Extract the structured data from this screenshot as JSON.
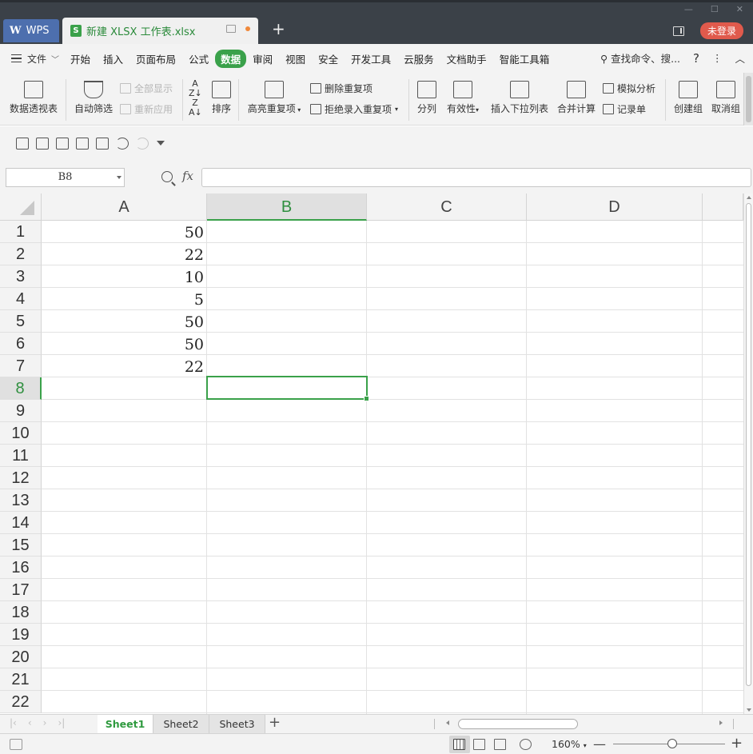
{
  "titlebar": {
    "app_tab": "WPS",
    "doc_tab": "新建 XLSX 工作表.xlsx",
    "new_tab": "+",
    "login": "未登录"
  },
  "menu": {
    "file": "文件",
    "items": [
      "开始",
      "插入",
      "页面布局",
      "公式",
      "数据",
      "审阅",
      "视图",
      "安全",
      "开发工具",
      "云服务",
      "文档助手",
      "智能工具箱"
    ],
    "active": "数据",
    "search": "查找命令、搜..."
  },
  "ribbon": {
    "pivot": "数据透视表",
    "autofilter": "自动筛选",
    "show_all": "全部显示",
    "reapply": "重新应用",
    "sort": "排序",
    "highlight_dup": "高亮重复项",
    "remove_dup": "删除重复项",
    "reject_dup": "拒绝录入重复项",
    "split": "分列",
    "validity": "有效性",
    "dropdown": "插入下拉列表",
    "consolidate": "合并计算",
    "whatif": "模拟分析",
    "record": "记录单",
    "group": "创建组",
    "ungroup": "取消组"
  },
  "formula": {
    "namebox": "B8",
    "fx": "fx",
    "value": ""
  },
  "grid": {
    "columns": [
      "A",
      "B",
      "C",
      "D"
    ],
    "selected_column": "B",
    "rows": [
      "1",
      "2",
      "3",
      "4",
      "5",
      "6",
      "7",
      "8",
      "9",
      "10",
      "11",
      "12",
      "13",
      "14",
      "15",
      "16",
      "17",
      "18",
      "19",
      "20",
      "21",
      "22"
    ],
    "selected_row": "8",
    "colA_values": [
      "50",
      "22",
      "10",
      "5",
      "50",
      "50",
      "22"
    ]
  },
  "sheets": [
    "Sheet1",
    "Sheet2",
    "Sheet3"
  ],
  "active_sheet": "Sheet1",
  "status": {
    "zoom": "160%",
    "zoom_level": 0.53
  },
  "colors": {
    "accent": "#3aa14a",
    "title_bg": "#3b4148",
    "login": "#e05a4c"
  }
}
